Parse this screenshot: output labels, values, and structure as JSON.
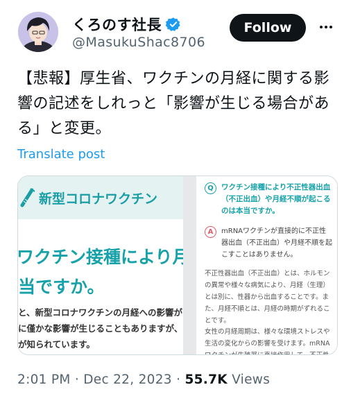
{
  "author": {
    "name": "くろのす社長",
    "handle": "@MasukuShac8706"
  },
  "follow_label": "Follow",
  "post": {
    "text": "【悲報】厚生省、ワクチンの月経に関する影響の記述をしれっと「影響が生じる場合がある」と変更。",
    "translate_label": "Translate post"
  },
  "media": {
    "left": {
      "title": "新型コロナワクチン",
      "question_line1": "ワクチン接種により月経",
      "question_line2": "当ですか。",
      "para_line1": "と、新型コロナワクチンの月経への影響が",
      "para_line2": "に僅かな影響が生じることもありますが、",
      "para_line3": "が知られています。"
    },
    "right": {
      "q_badge": "Q",
      "a_badge": "A",
      "question": "ワクチン接種により不正性器出血（不正出血）や月経不順が起こるのは本当ですか。",
      "answer": "mRNAワクチンが直接的に不正性器出血（不正出血）や月経不順を起こすことはありません。",
      "para1": "不正性器出血（不正出血）とは、ホルモンの異常や様々な病気により、月経（生理）とは別に、性器から出血することです。また、月経不順とは、月経の時期がずれることです。",
      "para2": "女性の月経周期は、様々な環境ストレスや生活の変化からの影響を受けます。mRNAワクチンが生殖器に直接作用して、不正性器出血"
    }
  },
  "meta": {
    "time": "2:01 PM",
    "date": "Dec 22, 2023",
    "sep": "·",
    "views_count": "55.7K",
    "views_label": "Views"
  },
  "colors": {
    "accent": "#1d9bf0",
    "teal": "#17a2aa"
  }
}
